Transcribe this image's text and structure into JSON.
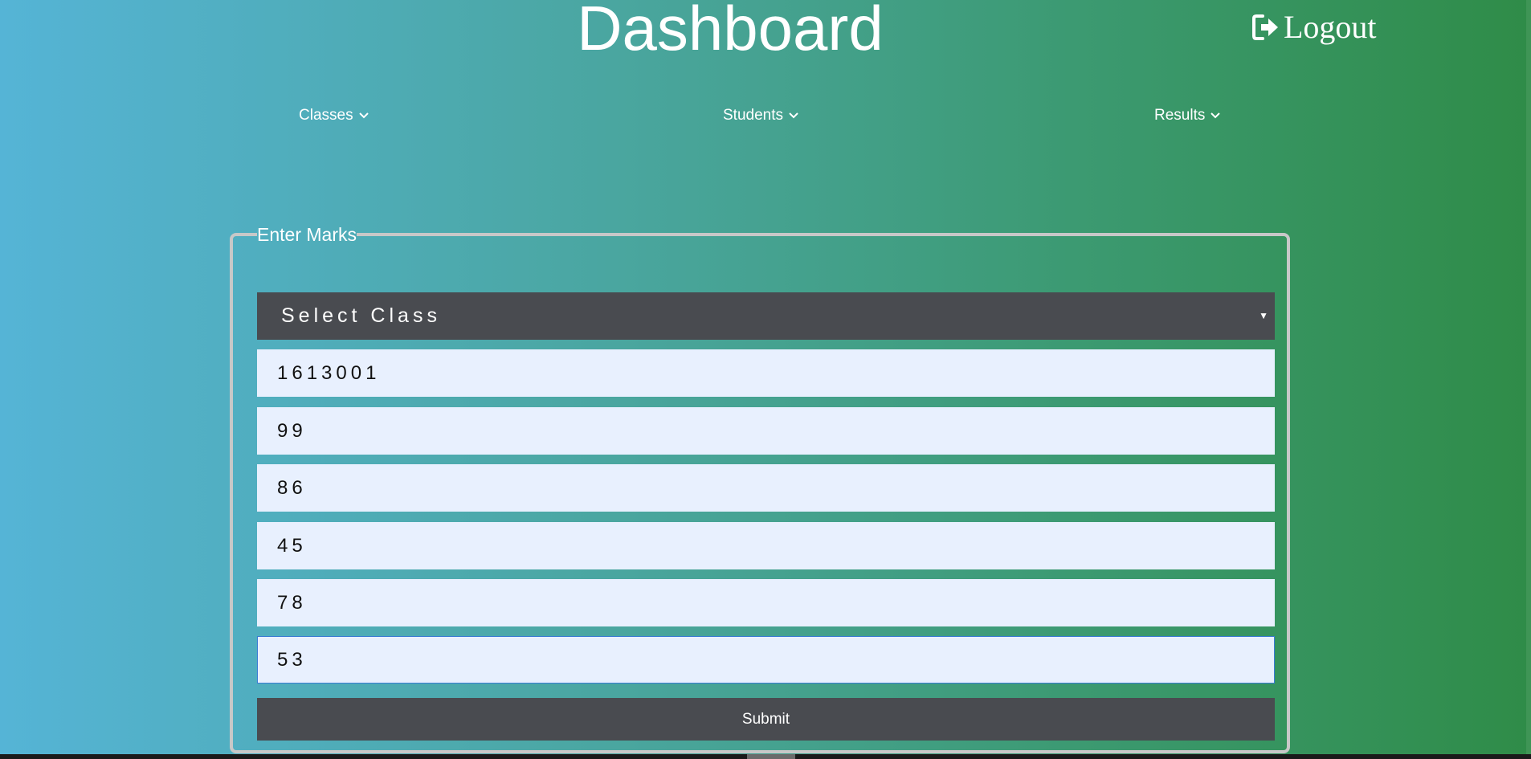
{
  "header": {
    "title": "Dashboard",
    "logout_label": "Logout"
  },
  "nav": {
    "items": [
      {
        "label": "Classes"
      },
      {
        "label": "Students"
      },
      {
        "label": "Results"
      }
    ]
  },
  "form": {
    "legend": "Enter Marks",
    "class_select": {
      "selected": "Select Class"
    },
    "fields": [
      {
        "value": "1613001"
      },
      {
        "value": "99"
      },
      {
        "value": "86"
      },
      {
        "value": "45"
      },
      {
        "value": "78"
      },
      {
        "value": "53"
      }
    ],
    "submit_label": "Submit"
  },
  "colors": {
    "gradient_left": "#55b4d6",
    "gradient_right": "#2f8c48",
    "dark_control": "#494b50",
    "input_bg": "#e8f0fe",
    "focus_border": "#3a7bd5"
  },
  "icons": {
    "logout": "sign-out-icon",
    "nav_dropdown": "chevron-down-icon",
    "select_dropdown": "caret-down-icon"
  }
}
